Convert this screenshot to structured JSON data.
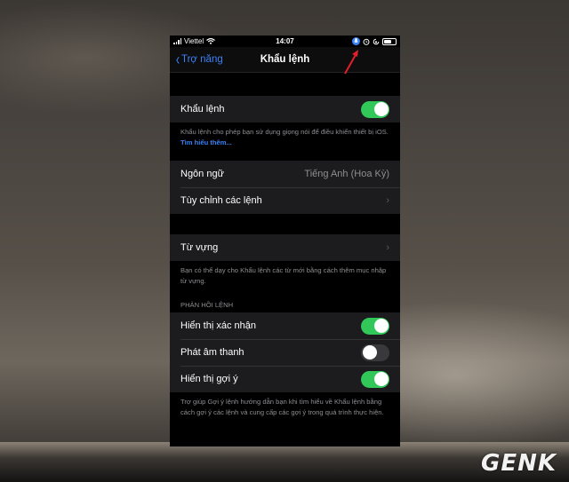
{
  "status_bar": {
    "carrier": "Viettel",
    "time": "14:07"
  },
  "nav": {
    "back_label": "Trợ năng",
    "title": "Khẩu lệnh"
  },
  "voice_control": {
    "label": "Khẩu lệnh",
    "enabled": true,
    "footer_text": "Khẩu lệnh cho phép bạn sử dụng giọng nói để điều khiển thiết bị iOS.",
    "learn_more": "Tìm hiểu thêm..."
  },
  "language": {
    "label": "Ngôn ngữ",
    "value": "Tiếng Anh (Hoa Kỳ)"
  },
  "customize_commands": {
    "label": "Tùy chỉnh các lệnh"
  },
  "vocabulary": {
    "label": "Từ vựng",
    "footer_text": "Bạn có thể dạy cho Khẩu lệnh các từ mới bằng cách thêm mục nhập từ vựng."
  },
  "command_feedback": {
    "header": "PHẢN HỒI LỆNH",
    "show_confirmation": {
      "label": "Hiển thị xác nhận",
      "enabled": true
    },
    "play_sound": {
      "label": "Phát âm thanh",
      "enabled": false
    },
    "show_hints": {
      "label": "Hiển thị gợi ý",
      "enabled": true
    },
    "footer_text": "Trợ giúp Gợi ý lệnh hướng dẫn bạn khi tìm hiểu về Khẩu lệnh bằng cách gợi ý các lệnh và cung cấp các gợi ý trong quá trình thực hiện."
  },
  "watermark": "GENK",
  "colors": {
    "accent": "#3a82f7",
    "toggle_on": "#32c759",
    "annotation_arrow": "#e0202a"
  },
  "icons": [
    "signal-icon",
    "wifi-icon",
    "mic-status-icon",
    "alarm-icon",
    "lock-rotation-icon",
    "battery-icon",
    "chevron-left-icon",
    "chevron-right-icon"
  ]
}
